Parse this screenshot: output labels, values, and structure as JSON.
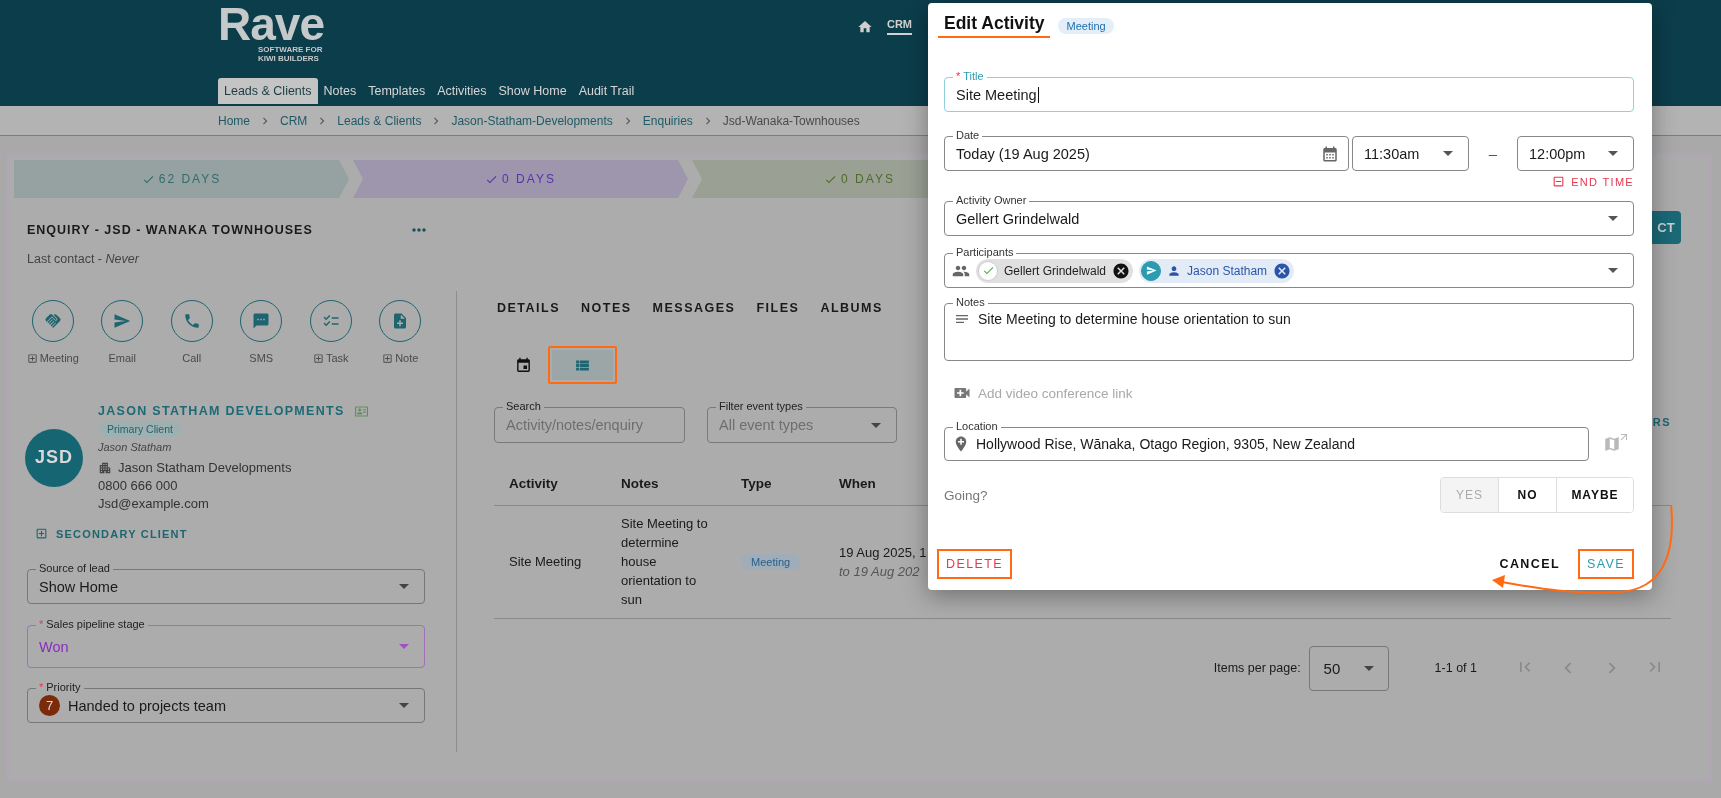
{
  "header": {
    "logo": {
      "name": "Rave",
      "tagline": "SOFTWARE FOR KIWI BUILDERS"
    },
    "top_nav": [
      {
        "label": "CRM",
        "selected": true
      }
    ],
    "tabs": [
      {
        "label": "Leads & Clients",
        "selected": true
      },
      {
        "label": "Notes",
        "selected": false
      },
      {
        "label": "Templates",
        "selected": false
      },
      {
        "label": "Activities",
        "selected": false
      },
      {
        "label": "Show Home",
        "selected": false
      },
      {
        "label": "Audit Trail",
        "selected": false
      }
    ]
  },
  "breadcrumbs": [
    {
      "label": "Home",
      "current": false
    },
    {
      "label": "CRM",
      "current": false
    },
    {
      "label": "Leads & Clients",
      "current": false
    },
    {
      "label": "Jason-Statham-Developments",
      "current": false
    },
    {
      "label": "Enquiries",
      "current": false
    },
    {
      "label": "Jsd-Wanaka-Townhouses",
      "current": true
    }
  ],
  "stages": [
    {
      "label": "62 DAYS",
      "done": true,
      "color": "#2f6d6d"
    },
    {
      "label": "0 DAYS",
      "done": true,
      "color": "#5a2fb0"
    },
    {
      "label": "0 DAYS",
      "done": true,
      "color": "#4d6b2a"
    }
  ],
  "enquiry": {
    "title": "ENQUIRY - JSD - WANAKA TOWNHOUSES",
    "last_contact": "Last contact - *Never*"
  },
  "action_button": "CT",
  "actions": [
    {
      "label": "Meeting",
      "kind": "add"
    },
    {
      "label": "Email",
      "kind": "direct"
    },
    {
      "label": "Call",
      "kind": "direct"
    },
    {
      "label": "SMS",
      "kind": "direct"
    },
    {
      "label": "Task",
      "kind": "add"
    },
    {
      "label": "Note",
      "kind": "add"
    }
  ],
  "client": {
    "initials": "JSD",
    "name": "JASON STATHAM DEVELOPMENTS",
    "badge": "Primary Client",
    "contact": "Jason Statham",
    "company": "Jason Statham Developments",
    "phone": "0800 666 000",
    "email": "Jsd@example.com"
  },
  "secondary_client_link": "SECONDARY CLIENT",
  "fields": [
    {
      "label": "Source of lead",
      "value": "Show Home",
      "kind": "plain"
    },
    {
      "required_mark": "*",
      "label": "Sales pipeline stage",
      "value": "Won",
      "kind": "stage"
    },
    {
      "required_mark": "*",
      "label": "Priority",
      "value": "Handed to projects team",
      "kind": "badge",
      "badge": "7"
    }
  ],
  "detail_tabs": [
    {
      "label": "DETAILS",
      "selected": false
    },
    {
      "label": "NOTES",
      "selected": false
    },
    {
      "label": "MESSAGES",
      "selected": false
    },
    {
      "label": "FILES",
      "selected": false
    },
    {
      "label": "ALBUMS",
      "selected": false
    }
  ],
  "views": [
    {
      "kind": "calendar",
      "selected": false,
      "annotated": false
    },
    {
      "kind": "list",
      "selected": true,
      "annotated": true
    }
  ],
  "filters": {
    "search": {
      "label": "Search",
      "placeholder": "Activity/notes/enquiry"
    },
    "event_types": {
      "label": "Filter event types",
      "placeholder": "All event types"
    },
    "link": "RS"
  },
  "table": {
    "columns": [
      "Activity",
      "Notes",
      "Type",
      "When"
    ],
    "rows": [
      {
        "activity": "Site Meeting",
        "notes": "Site Meeting to determine house orientation to sun",
        "type": "Meeting",
        "when": "19 Aug 2025, 1",
        "when_end": "to 19 Aug 202"
      }
    ]
  },
  "pagination": {
    "label": "Items per page:",
    "page_size": "50",
    "range": "1-1 of 1"
  },
  "dialog": {
    "title": "Edit Activity",
    "title_annotated": true,
    "type_badge": "Meeting",
    "title_field": {
      "required_mark": "*",
      "label": "Title",
      "value": "Site Meeting",
      "focused": true
    },
    "date": {
      "label": "Date",
      "value": "Today (19 Aug 2025)"
    },
    "start_time": "11:30am",
    "time_separator": "–",
    "end_time": "12:00pm",
    "end_time_button": "END TIME",
    "owner": {
      "label": "Activity Owner",
      "value": "Gellert Grindelwald"
    },
    "participants": {
      "label": "Participants",
      "chips": [
        {
          "name": "Gellert Grindelwald",
          "kind": "accepted"
        },
        {
          "name": "Jason Statham",
          "kind": "invited"
        }
      ]
    },
    "notes": {
      "label": "Notes",
      "value": "Site Meeting to determine house orientation to sun"
    },
    "video_link": "Add video conference link",
    "location": {
      "label": "Location",
      "value": "Hollywood Rise, Wānaka, Otago Region, 9305, New Zealand"
    },
    "going": {
      "label": "Going?",
      "options": [
        {
          "label": "YES",
          "selected": true
        },
        {
          "label": "NO",
          "selected": false
        },
        {
          "label": "MAYBE",
          "selected": false
        }
      ]
    },
    "buttons": [
      {
        "label": "DELETE",
        "kind": "danger",
        "annotated": true
      },
      {
        "label": "CANCEL",
        "kind": "plain",
        "annotated": false,
        "arrow": true
      },
      {
        "label": "SAVE",
        "kind": "primary",
        "annotated": true
      }
    ]
  }
}
